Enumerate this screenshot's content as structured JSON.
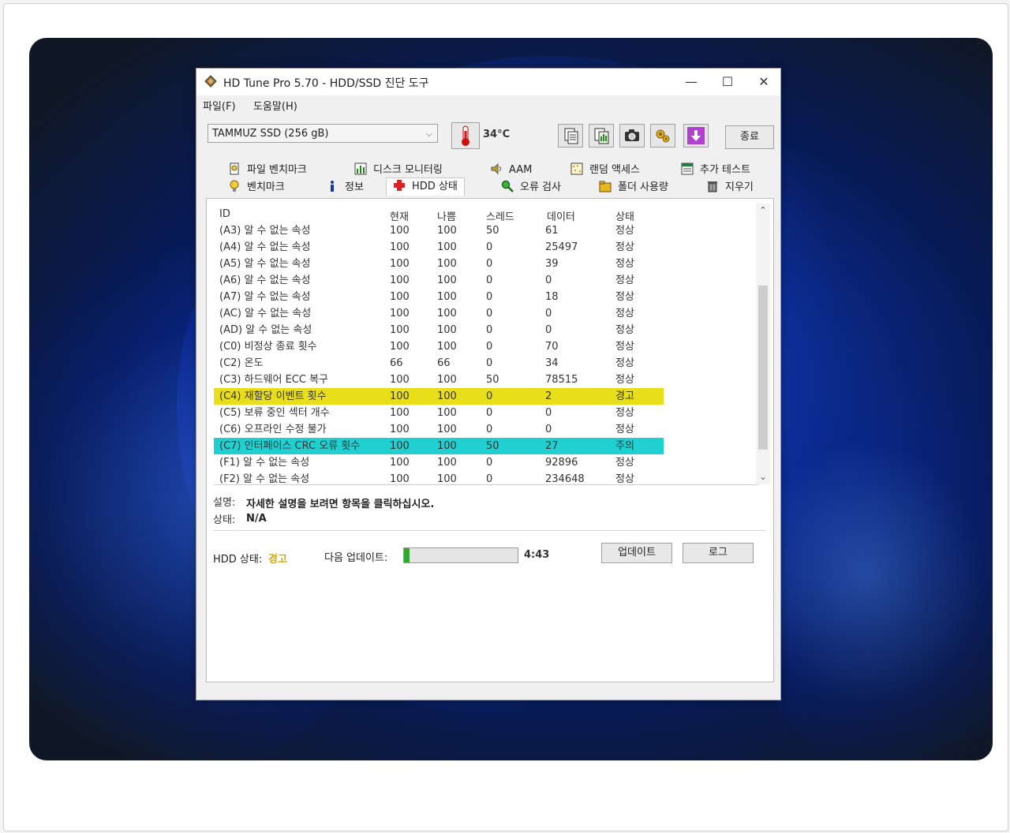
{
  "window": {
    "title": "HD Tune Pro 5.70 - HDD/SSD 진단 도구",
    "controls": {
      "minimize": "—",
      "maximize": "☐",
      "close": "✕"
    }
  },
  "menu": {
    "file": "파일(F)",
    "help": "도움말(H)"
  },
  "toolbar": {
    "drive": "TAMMUZ SSD (256 gB)",
    "temperature": "34°C",
    "exit_label": "종료",
    "icons": [
      "copy-text-icon",
      "copy-screen-icon",
      "camera-icon",
      "options-icon",
      "save-download-icon"
    ]
  },
  "tabs": {
    "row1": [
      {
        "label": "파일 벤치마크",
        "icon": "file-benchmark-icon"
      },
      {
        "label": "디스크 모니터링",
        "icon": "disk-monitor-icon"
      },
      {
        "label": "AAM",
        "icon": "speaker-icon"
      },
      {
        "label": "랜덤 액세스",
        "icon": "random-access-icon"
      },
      {
        "label": "추가 테스트",
        "icon": "extra-tests-icon"
      }
    ],
    "row2": [
      {
        "label": "벤치마크",
        "icon": "lightbulb-icon"
      },
      {
        "label": "정보",
        "icon": "info-icon"
      },
      {
        "label": "HDD 상태",
        "icon": "health-cross-icon"
      },
      {
        "label": "오류 검사",
        "icon": "magnifier-icon"
      },
      {
        "label": "폴더 사용량",
        "icon": "folder-icon"
      },
      {
        "label": "지우기",
        "icon": "trash-icon"
      }
    ]
  },
  "smart": {
    "headers": [
      "ID",
      "현재",
      "나쁨",
      "스레드",
      "데이터",
      "상태"
    ],
    "rows": [
      {
        "id": "(A3) 알 수 없는 속성",
        "current": "100",
        "worst": "100",
        "threshold": "50",
        "data": "61",
        "status": "정상",
        "level": "normal"
      },
      {
        "id": "(A4) 알 수 없는 속성",
        "current": "100",
        "worst": "100",
        "threshold": "0",
        "data": "25497",
        "status": "정상",
        "level": "normal"
      },
      {
        "id": "(A5) 알 수 없는 속성",
        "current": "100",
        "worst": "100",
        "threshold": "0",
        "data": "39",
        "status": "정상",
        "level": "normal"
      },
      {
        "id": "(A6) 알 수 없는 속성",
        "current": "100",
        "worst": "100",
        "threshold": "0",
        "data": "0",
        "status": "정상",
        "level": "normal"
      },
      {
        "id": "(A7) 알 수 없는 속성",
        "current": "100",
        "worst": "100",
        "threshold": "0",
        "data": "18",
        "status": "정상",
        "level": "normal"
      },
      {
        "id": "(AC) 알 수 없는 속성",
        "current": "100",
        "worst": "100",
        "threshold": "0",
        "data": "0",
        "status": "정상",
        "level": "normal"
      },
      {
        "id": "(AD) 알 수 없는 속성",
        "current": "100",
        "worst": "100",
        "threshold": "0",
        "data": "0",
        "status": "정상",
        "level": "normal"
      },
      {
        "id": "(C0) 비정상 종료 횟수",
        "current": "100",
        "worst": "100",
        "threshold": "0",
        "data": "70",
        "status": "정상",
        "level": "normal"
      },
      {
        "id": "(C2) 온도",
        "current": "66",
        "worst": "66",
        "threshold": "0",
        "data": "34",
        "status": "정상",
        "level": "normal"
      },
      {
        "id": "(C3) 하드웨어 ECC 복구",
        "current": "100",
        "worst": "100",
        "threshold": "50",
        "data": "78515",
        "status": "정상",
        "level": "normal"
      },
      {
        "id": "(C4) 재할당 이벤트 횟수",
        "current": "100",
        "worst": "100",
        "threshold": "0",
        "data": "2",
        "status": "경고",
        "level": "warn"
      },
      {
        "id": "(C5) 보류 중인 섹터 개수",
        "current": "100",
        "worst": "100",
        "threshold": "0",
        "data": "0",
        "status": "정상",
        "level": "normal"
      },
      {
        "id": "(C6) 오프라인 수정 불가",
        "current": "100",
        "worst": "100",
        "threshold": "0",
        "data": "0",
        "status": "정상",
        "level": "normal"
      },
      {
        "id": "(C7) 인터페이스 CRC 오류 횟수",
        "current": "100",
        "worst": "100",
        "threshold": "50",
        "data": "27",
        "status": "주의",
        "level": "caution"
      },
      {
        "id": "(F1) 알 수 없는 속성",
        "current": "100",
        "worst": "100",
        "threshold": "0",
        "data": "92896",
        "status": "정상",
        "level": "normal"
      },
      {
        "id": "(F2) 알 수 없는 속성",
        "current": "100",
        "worst": "100",
        "threshold": "0",
        "data": "234648",
        "status": "정상",
        "level": "normal"
      }
    ]
  },
  "description": {
    "desc_label": "설명:",
    "desc_value": "자세한 설명을 보려면 항목을 클릭하십시오.",
    "state_label": "상태:",
    "state_value": "N/A"
  },
  "status_bar": {
    "hdd_label": "HDD 상태:",
    "hdd_value": "경고",
    "next_update_label": "다음 업데이트:",
    "progress_fraction": 0.05,
    "countdown": "4:43",
    "update_button": "업데이트",
    "log_button": "로그"
  },
  "colors": {
    "warn_row": "#e8de1a",
    "caution_row": "#20d0d0",
    "warning_text": "#d9a800",
    "progress": "#2fa82f"
  }
}
